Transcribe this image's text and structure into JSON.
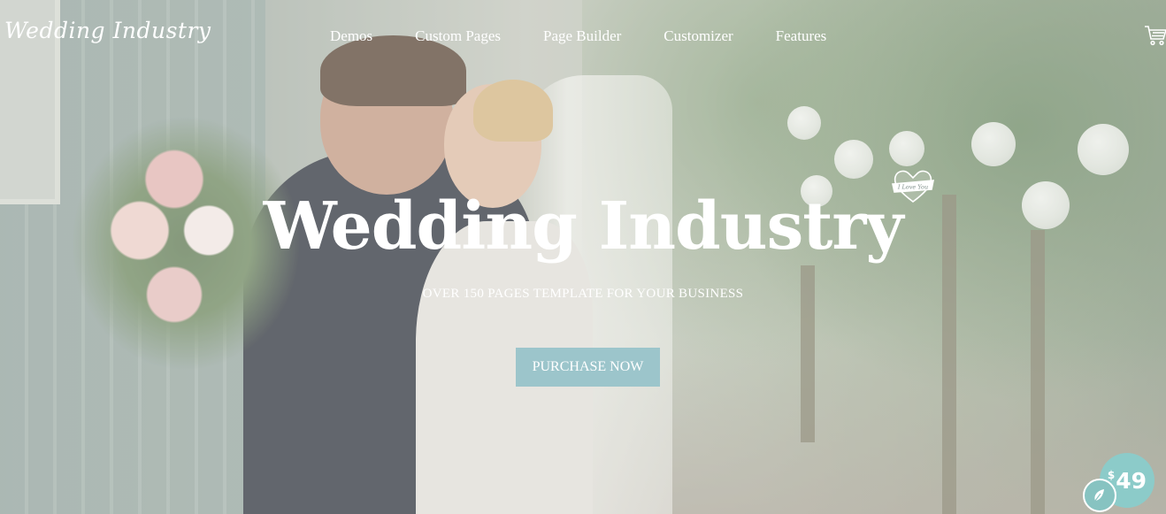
{
  "header": {
    "logo": "Wedding Industry",
    "nav": [
      "Demos",
      "Custom Pages",
      "Page Builder",
      "Customizer",
      "Features"
    ],
    "cart_icon": "shopping-cart-icon"
  },
  "hero": {
    "title": "Wedding Industry",
    "subtitle": "OVER 150 PAGES TEMPLATE FOR YOUR BUSINESS",
    "cta_label": "PURCHASE NOW",
    "heart_badge_text": "I Love You",
    "heart_icon": "heart-badge-icon"
  },
  "price_badge": {
    "currency": "$",
    "amount": "49",
    "icon": "envato-leaf-icon"
  },
  "colors": {
    "accent": "#9cc5cb",
    "badge": "#8ccbc9",
    "text": "#ffffff"
  }
}
